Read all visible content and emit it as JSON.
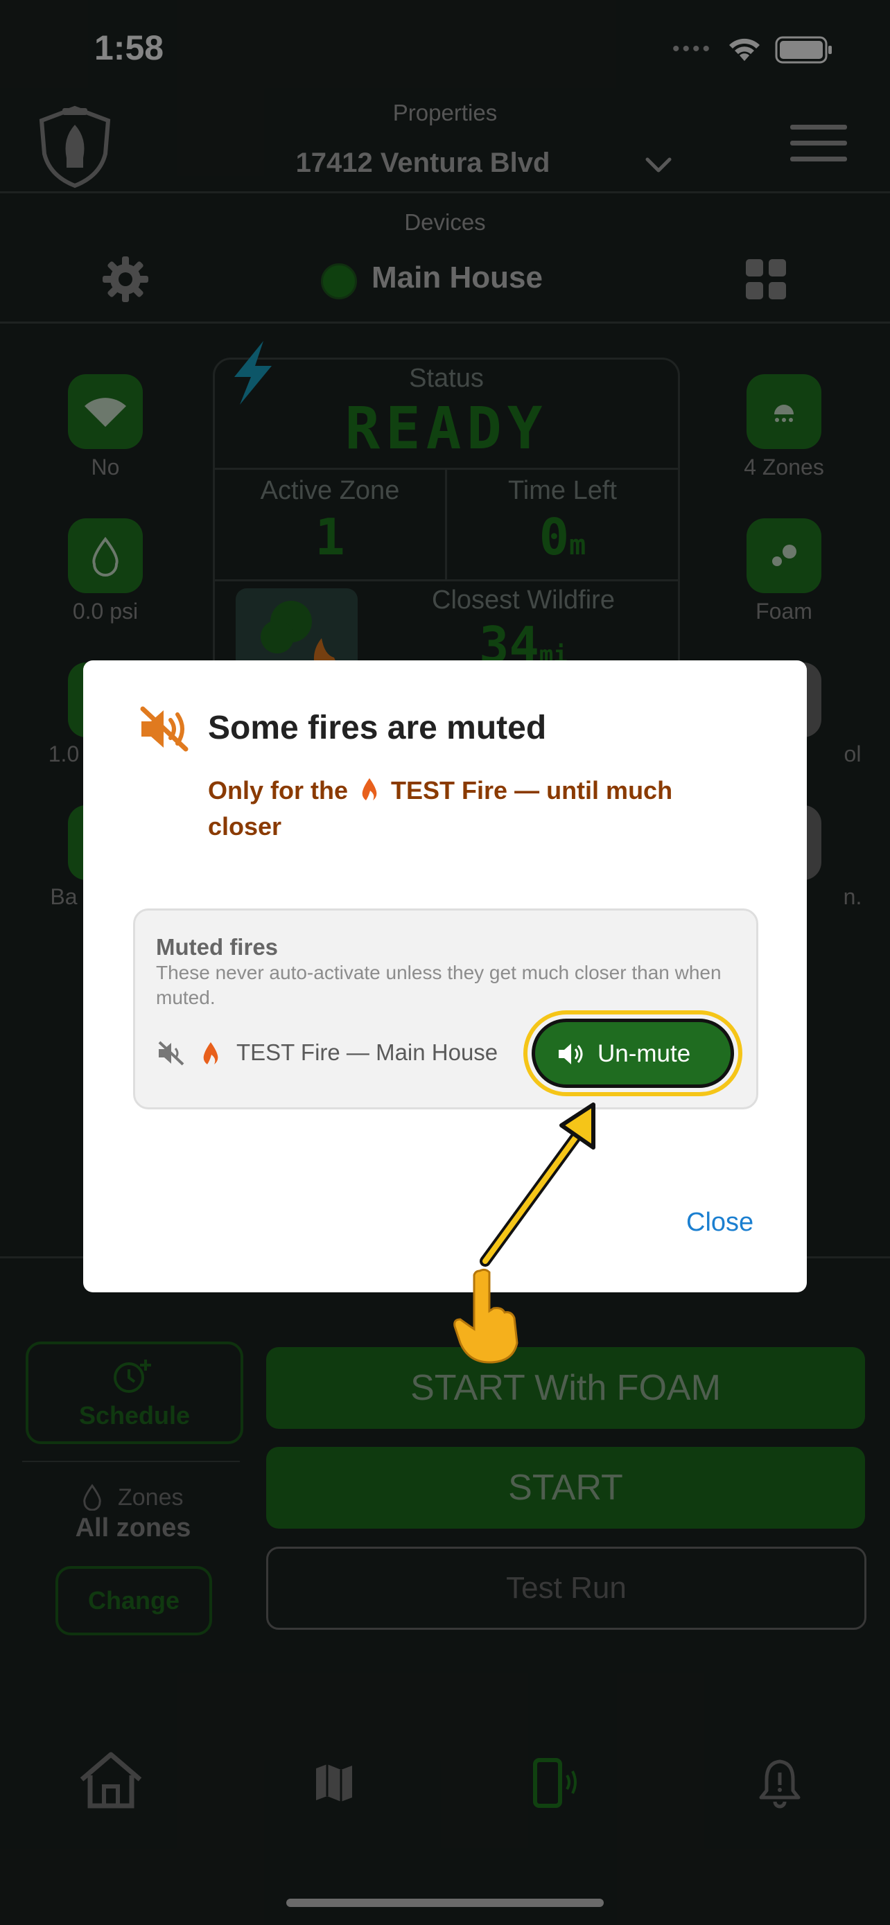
{
  "status_bar": {
    "time": "1:58"
  },
  "header": {
    "properties_label": "Properties",
    "address": "17412 Ventura Blvd",
    "devices_label": "Devices",
    "device_name": "Main House"
  },
  "status_panel": {
    "status_label": "Status",
    "status_value": "READY",
    "active_zone_label": "Active Zone",
    "active_zone_value": "1",
    "time_left_label": "Time Left",
    "time_left_value": "0",
    "time_left_unit": "m",
    "closest_label": "Closest Wildfire",
    "closest_value": "34",
    "closest_unit": "mi"
  },
  "left_tiles": [
    {
      "label": "No"
    },
    {
      "label": "0.0 psi"
    },
    {
      "label": "1.0"
    },
    {
      "label": "Ba"
    }
  ],
  "right_tiles": [
    {
      "label": "4 Zones"
    },
    {
      "label": "Foam"
    },
    {
      "label": "ol"
    },
    {
      "label": "n."
    }
  ],
  "controls": {
    "schedule": "Schedule",
    "zones_label": "Zones",
    "zones_value": "All zones",
    "change": "Change",
    "start_foam": "START With FOAM",
    "start": "START",
    "test_run": "Test Run"
  },
  "modal": {
    "title": "Some fires are muted",
    "subtitle_prefix": "Only for the",
    "subtitle_rest": "TEST Fire — until much closer",
    "card_title": "Muted fires",
    "card_desc": "These never auto-activate unless they get much closer than when muted.",
    "item": "TEST Fire — Main House",
    "unmute": "Un-mute",
    "close": "Close"
  },
  "colors": {
    "accent_green": "#1e7b1e",
    "highlight_yellow": "#f5c518",
    "link_blue": "#1b7fd0",
    "subtitle_brown": "#8a3a00",
    "muted_orange": "#e07a1f"
  }
}
